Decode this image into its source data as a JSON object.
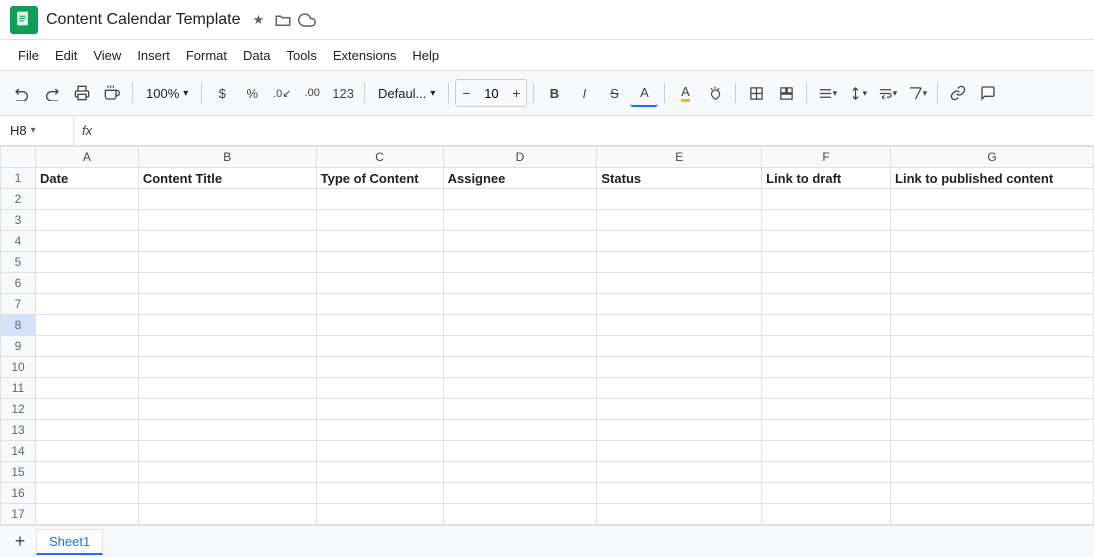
{
  "title": {
    "app_icon_alt": "Google Sheets",
    "doc_title": "Content Calendar Template",
    "star_icon": "★",
    "folder_icon": "📁",
    "cloud_icon": "☁"
  },
  "menu": {
    "items": [
      "File",
      "Edit",
      "View",
      "Insert",
      "Format",
      "Data",
      "Tools",
      "Extensions",
      "Help"
    ]
  },
  "toolbar": {
    "undo_label": "↩",
    "redo_label": "↪",
    "print_label": "🖨",
    "paintformat_label": "🖌",
    "zoom_value": "100%",
    "zoom_arrow": "▾",
    "currency_label": "$",
    "percent_label": "%",
    "decimal_dec_label": ".0↙",
    "decimal_inc_label": ".00",
    "format_label": "123",
    "font_label": "Defaul...",
    "font_arrow": "▾",
    "font_size_minus": "−",
    "font_size_value": "10",
    "font_size_plus": "+",
    "bold_label": "B",
    "italic_label": "I",
    "strikethrough_label": "S̶",
    "underline_label": "A",
    "fill_color_label": "A",
    "borders_label": "⊞",
    "merge_label": "⊟",
    "align_h_label": "≡",
    "align_v_label": "⇅",
    "wrap_label": "↵",
    "rotate_label": "⟳",
    "link_label": "🔗",
    "comment_label": "💬"
  },
  "formula_bar": {
    "cell_ref": "H8",
    "fx_label": "fx"
  },
  "sheet": {
    "columns": [
      "",
      "A",
      "B",
      "C",
      "D",
      "E",
      "F",
      "G"
    ],
    "header_row": {
      "date": "Date",
      "content_title": "Content Title",
      "type_of_content": "Type of Content",
      "assignee": "Assignee",
      "status": "Status",
      "link_to_draft": "Link to draft",
      "link_to_published": "Link to published content"
    },
    "rows": 17,
    "selected_cell": "H8",
    "selected_row": 8
  },
  "tabs": {
    "items": [
      "Sheet1"
    ],
    "active": "Sheet1",
    "add_label": "+"
  }
}
